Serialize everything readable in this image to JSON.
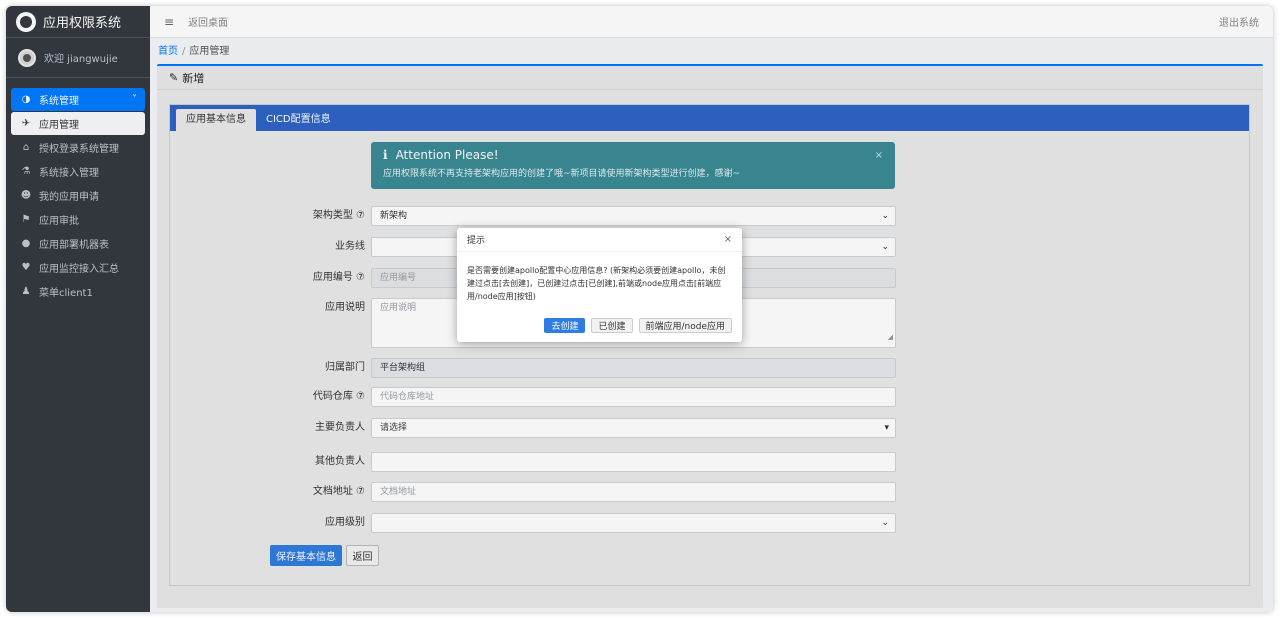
{
  "brand": {
    "title": "应用权限系统"
  },
  "user": {
    "welcome": "欢迎 jiangwujie"
  },
  "sidebar": {
    "group": {
      "label": "系统管理",
      "icon": "dashboard-icon",
      "chevron": "˅"
    },
    "items": [
      {
        "label": "应用管理",
        "icon": "plane-icon",
        "glyph": "✈",
        "active": true
      },
      {
        "label": "授权登录系统管理",
        "icon": "bank-icon",
        "glyph": "🏛"
      },
      {
        "label": "系统接入管理",
        "icon": "flask-icon",
        "glyph": "⚗"
      },
      {
        "label": "我的应用申请",
        "icon": "user-secret-icon",
        "glyph": "👤"
      },
      {
        "label": "应用审批",
        "icon": "flag-icon",
        "glyph": "⚑"
      },
      {
        "label": "应用部署机器表",
        "icon": "circle-icon",
        "glyph": "●"
      },
      {
        "label": "应用监控接入汇总",
        "icon": "heartbeat-icon",
        "glyph": "♥"
      },
      {
        "label": "菜单client1",
        "icon": "user-icon",
        "glyph": "👤"
      }
    ]
  },
  "topbar": {
    "menu_icon": "≡",
    "back_desktop": "返回桌面",
    "logout": "退出系统"
  },
  "breadcrumb": {
    "home": "首页",
    "sep": "/",
    "current": "应用管理"
  },
  "card": {
    "title": "新增",
    "edit_icon": "✎"
  },
  "tabs": [
    {
      "label": "应用基本信息",
      "active": true
    },
    {
      "label": "CICD配置信息",
      "active": false
    }
  ],
  "alert": {
    "title": "Attention Please!",
    "body": "应用权限系统不再支持老架构应用的创建了哦~新项目请使用新架构类型进行创建，感谢~",
    "close": "×"
  },
  "form": {
    "arch_type": {
      "label": "架构类型 ⑦",
      "value": "新架构"
    },
    "business_line": {
      "label": "业务线",
      "value": ""
    },
    "app_code": {
      "label": "应用编号 ⑦",
      "placeholder": "应用编号"
    },
    "app_desc": {
      "label": "应用说明",
      "placeholder": "应用说明"
    },
    "department": {
      "label": "归属部门",
      "value": "平台架构组"
    },
    "code_repo": {
      "label": "代码仓库 ⑦",
      "placeholder": "代码仓库地址"
    },
    "owner": {
      "label": "主要负责人",
      "placeholder": "请选择"
    },
    "other_owners": {
      "label": "其他负责人",
      "value": ""
    },
    "doc_url": {
      "label": "文档地址 ⑦",
      "placeholder": "文档地址"
    },
    "app_level": {
      "label": "应用级别",
      "value": ""
    },
    "save_label": "保存基本信息",
    "back_label": "返回"
  },
  "modal": {
    "title": "提示",
    "close": "×",
    "body": "是否需要创建apollo配置中心应用信息? (新架构必须要创建apollo，未创建过点击[去创建]，已创建过点击[已创建],前端或node应用点击[前端应用/node应用]按钮)",
    "btn_create": "去创建",
    "btn_created": "已创建",
    "btn_frontend": "前端应用/node应用"
  },
  "colors": {
    "primary": "#007bff",
    "sidebar": "#343a40",
    "alert": "#3b8a95",
    "tabs": "#2f64c6"
  }
}
